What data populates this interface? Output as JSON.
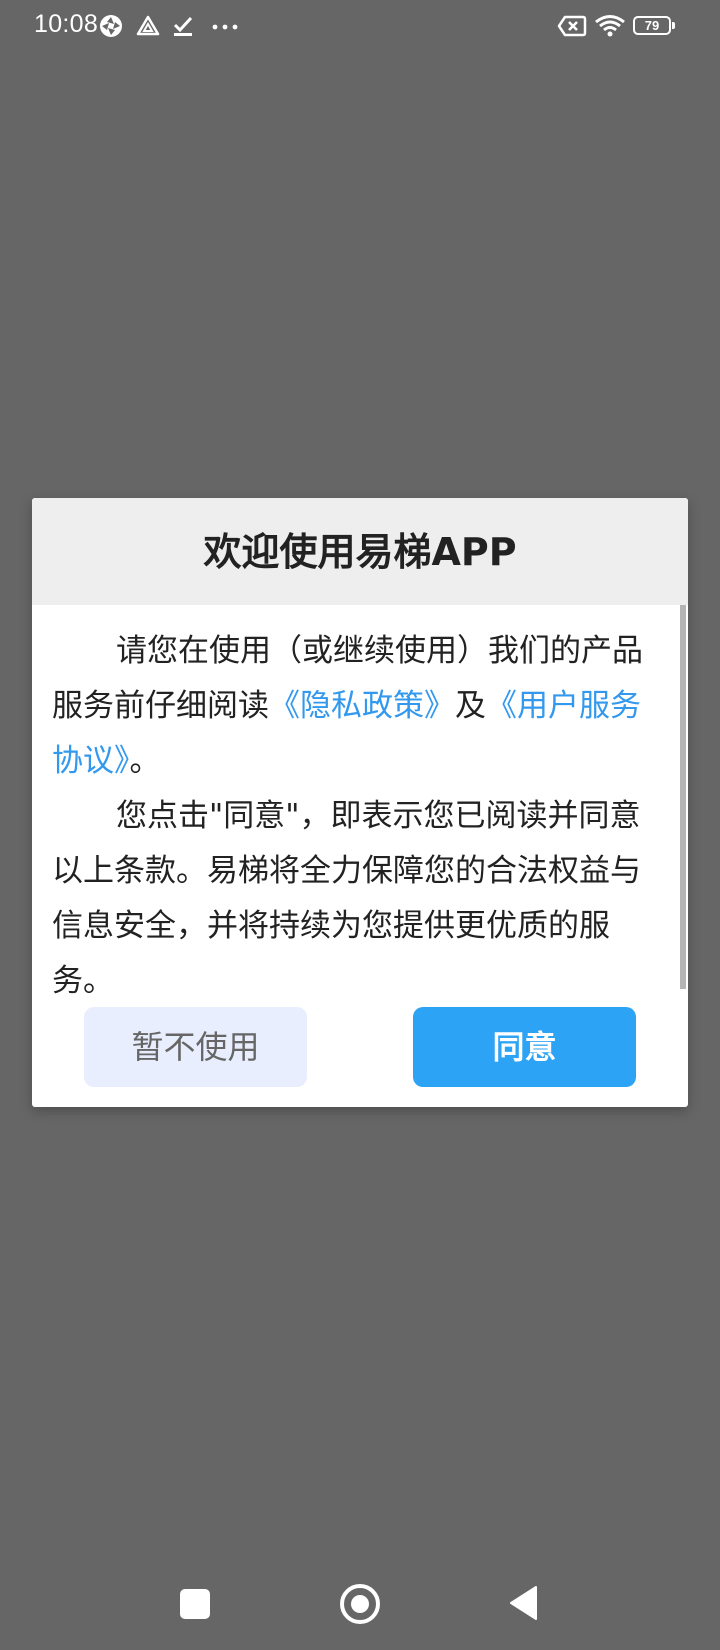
{
  "status_bar": {
    "time": "10:08",
    "battery_level": "79",
    "icons": [
      "sync-icon",
      "drive-icon",
      "check-icon",
      "more-dots-icon",
      "sim-off-icon",
      "wifi-icon",
      "battery-icon"
    ]
  },
  "dialog": {
    "title": "欢迎使用易梯APP",
    "paragraph1_prefix": "请您在使用（或继续使用）我们的产品服务前仔细阅读",
    "privacy_link": "《隐私政策》",
    "and_text": "及",
    "terms_link": "《用户服务协议》",
    "paragraph1_suffix": "。",
    "paragraph2": "您点击\"同意\"，即表示您已阅读并同意以上条款。易梯将全力保障您的合法权益与信息安全，并将持续为您提供更优质的服务。",
    "decline_label": "暂不使用",
    "agree_label": "同意"
  },
  "colors": {
    "backdrop": "#666666",
    "link": "#3399ee",
    "agree_button": "#2da3f5",
    "decline_button": "#e8eefd",
    "header_bg": "#eeeeee"
  },
  "nav_bar": {
    "icons": [
      "recents-square-icon",
      "home-circle-icon",
      "back-triangle-icon"
    ]
  }
}
